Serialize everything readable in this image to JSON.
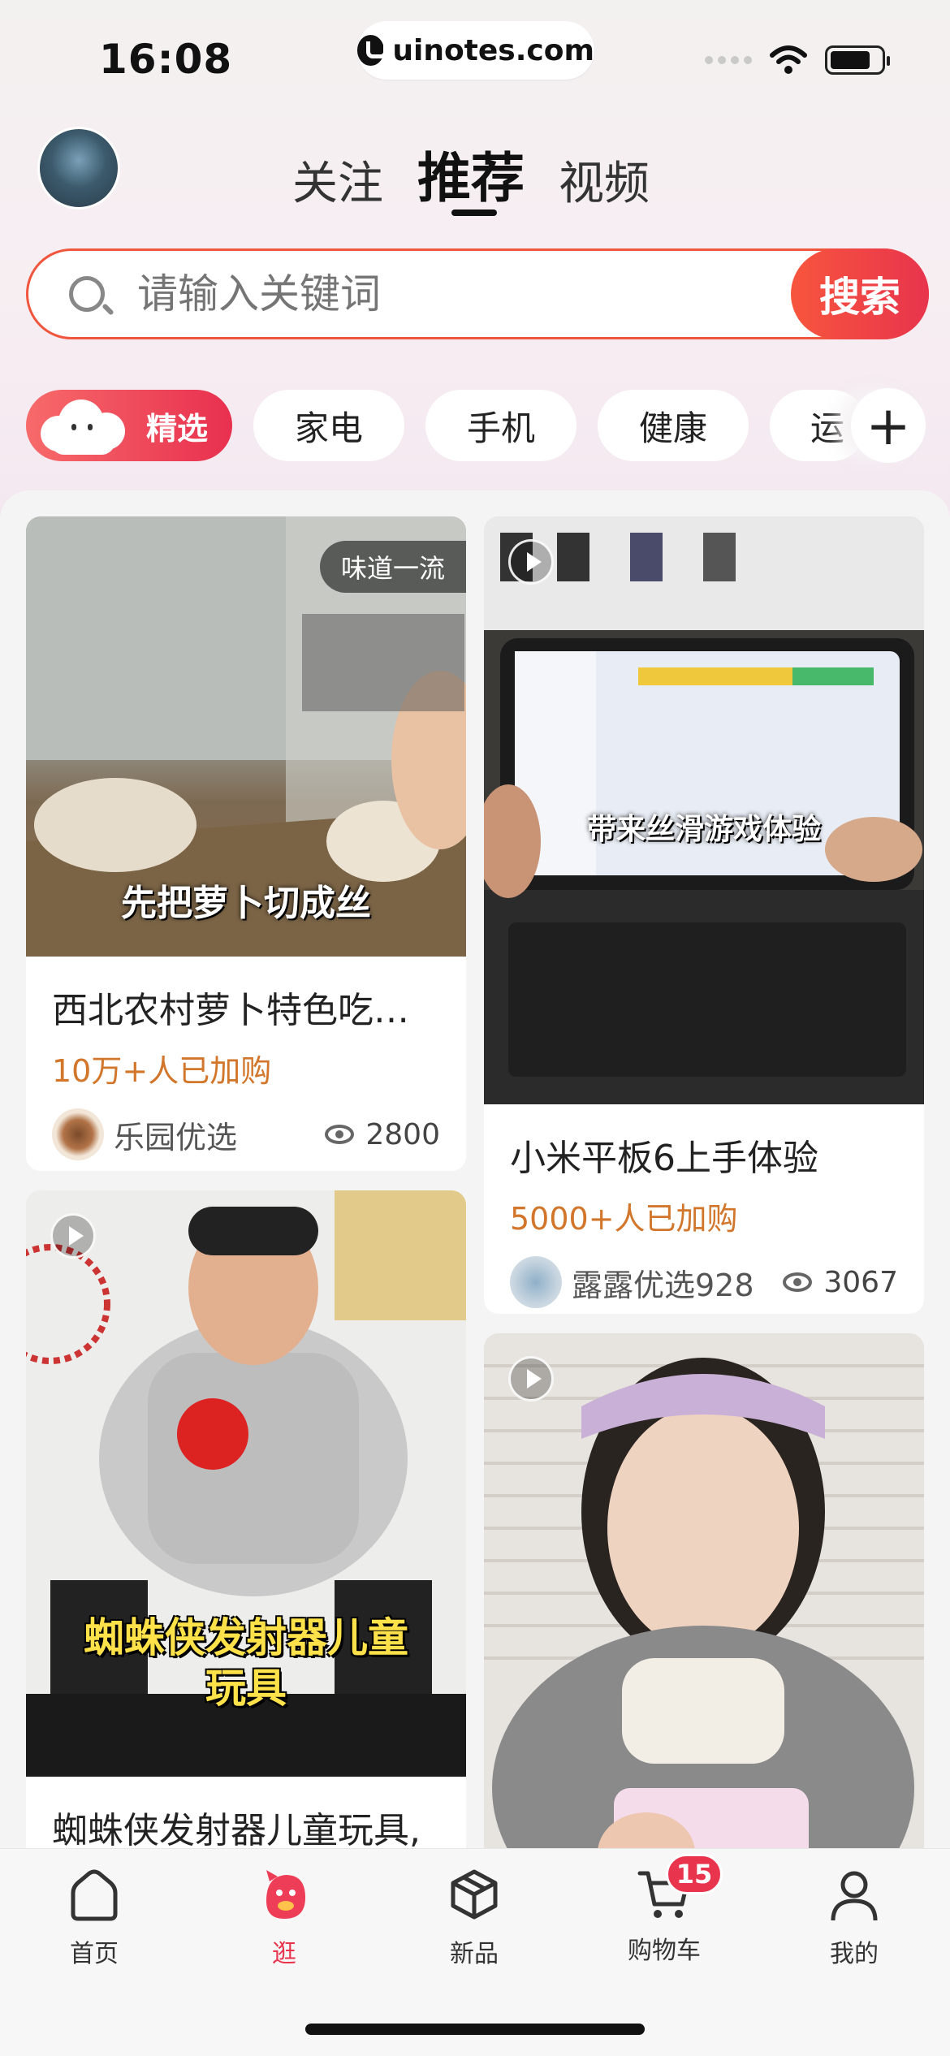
{
  "status_bar": {
    "time": "16:08",
    "url": "uinotes.com"
  },
  "header": {
    "tabs": [
      {
        "label": "关注",
        "active": false
      },
      {
        "label": "推荐",
        "active": true
      },
      {
        "label": "视频",
        "active": false
      }
    ]
  },
  "search": {
    "placeholder": "请输入关键词",
    "button_label": "搜索"
  },
  "categories": {
    "featured": "精选",
    "items": [
      "家电",
      "手机",
      "健康",
      "运"
    ],
    "add_label": "+"
  },
  "feed": {
    "cards": [
      {
        "badge": "味道一流",
        "caption": "先把萝卜切成丝",
        "title": "西北农村萝卜特色吃法...",
        "sold": "10万+人已加购",
        "shop": "乐园优选",
        "views": "2800"
      },
      {
        "caption": "带来丝滑游戏体验",
        "title": "小米平板6上手体验",
        "sold": "5000+人已加购",
        "shop": "露露优选928",
        "views": "3067"
      },
      {
        "caption_line1": "蜘蛛侠发射器儿童",
        "caption_line2": "玩具",
        "title": "蜘蛛侠发射器儿童玩具,"
      },
      {
        "has_video": true
      }
    ]
  },
  "bottom_nav": {
    "items": [
      {
        "label": "首页",
        "icon": "home-icon"
      },
      {
        "label": "逛",
        "icon": "browse-icon",
        "active": true
      },
      {
        "label": "新品",
        "icon": "box-icon"
      },
      {
        "label": "购物车",
        "icon": "cart-icon",
        "badge": "15"
      },
      {
        "label": "我的",
        "icon": "person-icon"
      }
    ]
  },
  "colors": {
    "accent": "#e8344d",
    "search_border": "#f0553e",
    "sold_text": "#d1762a"
  }
}
